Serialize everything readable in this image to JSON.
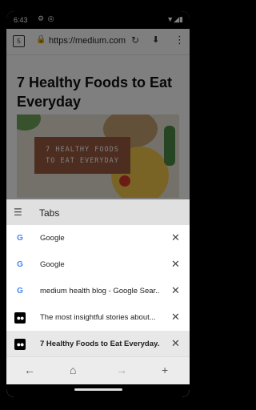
{
  "status_bar": {
    "time": "6:43",
    "left_icons": "⚙ ◎",
    "right_icons": "▼◢▮"
  },
  "url_bar": {
    "tab_count": "5",
    "url": "https://medium.com"
  },
  "article": {
    "title": "7 Healthy Foods to Eat Everyday",
    "image_text_line1": "7 HEALTHY FOODS",
    "image_text_line2": "TO EAT EVERYDAY"
  },
  "tabs_sheet": {
    "title": "Tabs",
    "tabs": [
      {
        "label": "Google",
        "favicon": "G"
      },
      {
        "label": "Google",
        "favicon": "G"
      },
      {
        "label": "medium health blog - Google Sear...",
        "favicon": "G"
      },
      {
        "label": "The most insightful stories about...",
        "favicon": "●●"
      },
      {
        "label": "7 Healthy Foods to Eat Everyday....",
        "favicon": "●●",
        "active": true
      }
    ]
  },
  "toolbar": {
    "back": "←",
    "home": "⌂",
    "forward": "→",
    "new_tab": "+"
  }
}
